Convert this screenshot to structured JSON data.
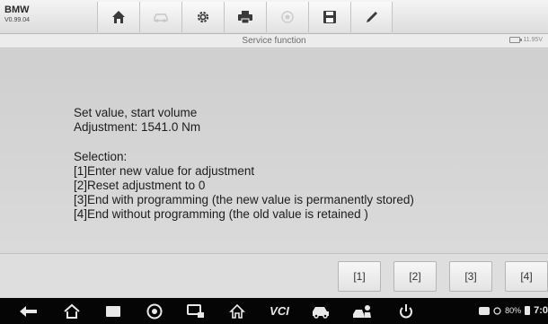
{
  "vehicle": {
    "make": "BMW",
    "version": "V0.99.04"
  },
  "toolbar": {
    "icons": [
      "home-icon",
      "vehicle-swap-icon",
      "settings-icon",
      "print-icon",
      "help-icon",
      "save-icon",
      "edit-icon"
    ]
  },
  "screen": {
    "title": "Service function",
    "voltage": "11.95V"
  },
  "message": {
    "line1": "Set value, start volume",
    "line2": "Adjustment: 1541.0 Nm",
    "selection_label": "Selection:",
    "options": [
      "[1]Enter new value for adjustment",
      "[2]Reset adjustment to 0",
      "[3]End with programming (the new value is permanently stored)",
      "[4]End without programming (the old value is retained )"
    ]
  },
  "buttons": [
    "[1]",
    "[2]",
    "[3]",
    "[4]"
  ],
  "status_bar": {
    "battery_percent": "80%",
    "time": "7:0"
  },
  "colors": {
    "nav_bar": "#050505",
    "content_bg": "#d4d4d4"
  }
}
